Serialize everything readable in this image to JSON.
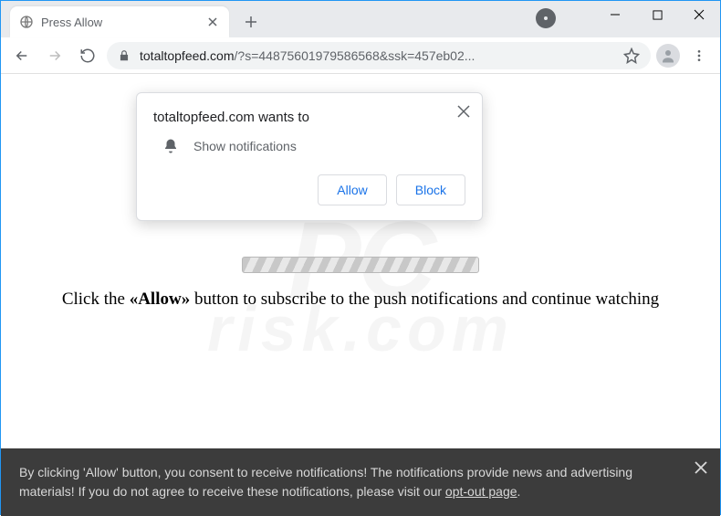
{
  "tab": {
    "title": "Press Allow"
  },
  "omnibox": {
    "domain": "totaltopfeed.com",
    "rest": "/?s=44875601979586568&ssk=457eb02..."
  },
  "permission": {
    "title": "totaltopfeed.com wants to",
    "option": "Show notifications",
    "allow": "Allow",
    "block": "Block"
  },
  "instruction": {
    "pre": "Click the ",
    "bold": "«Allow»",
    "post": " button to subscribe to the push notifications and continue watching"
  },
  "cookie": {
    "text1": "By clicking 'Allow' button, you consent to receive notifications! The notifications provide news and advertising materials! If you do not agree to receive these notifications, please visit our ",
    "link": "opt-out page",
    "text2": "."
  },
  "watermark": {
    "line1": "PC",
    "line2": "risk.com"
  }
}
